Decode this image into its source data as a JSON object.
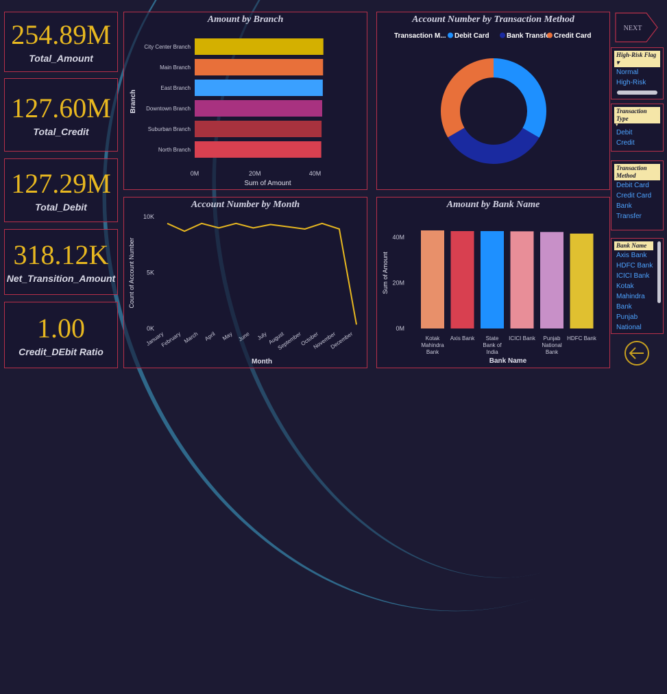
{
  "kpis": [
    {
      "value": "254.89M",
      "label": "Total_Amount"
    },
    {
      "value": "127.60M",
      "label": "Total_Credit"
    },
    {
      "value": "127.29M",
      "label": "Total_Debit"
    },
    {
      "value": "318.12K",
      "label": "Net_Transition_Amount"
    },
    {
      "value": "1.00",
      "label": "Credit_DEbit Ratio"
    }
  ],
  "nav": {
    "next_label": "NEXT"
  },
  "slicers": {
    "risk": {
      "title": "High-Risk Flag",
      "items": [
        "Normal",
        "High-Risk"
      ]
    },
    "type": {
      "title": "Transaction Type",
      "items": [
        "Debit",
        "Credit"
      ]
    },
    "method": {
      "title": "Transaction Method",
      "items": [
        "Debit Card",
        "Credit Card",
        "Bank Transfer"
      ]
    },
    "bank": {
      "title": "Bank Name",
      "items": [
        "Axis Bank",
        "HDFC Bank",
        "ICICI Bank",
        "Kotak Mahindra Bank",
        "Punjab National"
      ]
    }
  },
  "colors": {
    "accent": "#e8b820",
    "border": "#b8304a",
    "background": "#1c1a33"
  },
  "chart_data": [
    {
      "type": "bar",
      "orientation": "horizontal",
      "title": "Amount by Branch",
      "xlabel": "Sum of Amount",
      "ylabel": "Branch",
      "categories": [
        "City Center Branch",
        "Main Branch",
        "East Branch",
        "Downtown Branch",
        "Suburban Branch",
        "North Branch"
      ],
      "values": [
        42.8,
        42.7,
        42.6,
        42.4,
        42.2,
        42.1
      ],
      "colors": [
        "#d4b000",
        "#e8703a",
        "#3aa0ff",
        "#a83280",
        "#a8323e",
        "#d84050"
      ],
      "xticks": [
        "0M",
        "20M",
        "40M"
      ],
      "xlim": [
        0,
        44
      ]
    },
    {
      "type": "pie",
      "donut": true,
      "title": "Account Number by Transaction Method",
      "legend_title": "Transaction M...",
      "legend_position": "top",
      "categories": [
        "Debit Card",
        "Bank Transfer",
        "Credit Card"
      ],
      "values": [
        33.4,
        33.3,
        33.3
      ],
      "colors": [
        "#1e90ff",
        "#1a2aa0",
        "#e8703a"
      ]
    },
    {
      "type": "line",
      "title": "Account Number by Month",
      "xlabel": "Month",
      "ylabel": "Count of Account Number",
      "categories": [
        "January",
        "February",
        "March",
        "April",
        "May",
        "June",
        "July",
        "August",
        "September",
        "October",
        "November",
        "December"
      ],
      "values": [
        9400,
        8700,
        9400,
        9000,
        9400,
        9000,
        9300,
        9100,
        8900,
        9400,
        8900,
        350
      ],
      "yticks": [
        "0K",
        "5K",
        "10K"
      ],
      "ylim": [
        0,
        10000
      ],
      "color": "#e8b820"
    },
    {
      "type": "bar",
      "title": "Amount by Bank Name",
      "xlabel": "Bank Name",
      "ylabel": "Sum of Amount",
      "categories": [
        "Kotak Mahindra Bank",
        "Axis Bank",
        "State Bank of India",
        "ICICI Bank",
        "Punjab National Bank",
        "HDFC Bank"
      ],
      "values": [
        43.0,
        42.7,
        42.7,
        42.6,
        42.3,
        41.6
      ],
      "colors": [
        "#e8906a",
        "#d84050",
        "#1e90ff",
        "#e88e98",
        "#c890c8",
        "#e0c030"
      ],
      "yticks": [
        "0M",
        "20M",
        "40M"
      ],
      "ylim": [
        0,
        46
      ]
    }
  ]
}
